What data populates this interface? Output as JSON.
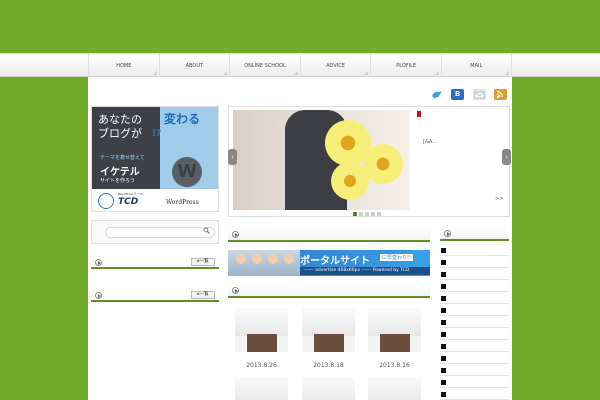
{
  "nav": {
    "items": [
      {
        "label": "HOME"
      },
      {
        "label": "ABOUT"
      },
      {
        "label": "ONLINE SCHOOL"
      },
      {
        "label": "ADVICE"
      },
      {
        "label": "PLOFILE"
      },
      {
        "label": "MAIL"
      }
    ]
  },
  "social": {
    "icons": [
      "bird-icon",
      "hatena-bookmark-icon",
      "mail-icon",
      "rss-icon"
    ],
    "b_label": "B"
  },
  "banner": {
    "line1": "あなたの",
    "line2": "ブログが",
    "kawaru": "変わる",
    "exclaim": "!?",
    "sub": "テーマを着せ替えて",
    "ikeru": "イケテル",
    "make": "サイトを作ろう",
    "tcd_small": "WordPressテーマ",
    "tcd": "TCD",
    "wordpress": "WordPress"
  },
  "sidebar": {
    "list_button": "▸一覧"
  },
  "slider": {
    "caption": "[&A...",
    "more": ">>",
    "dots_active": 1,
    "dots_total": 5
  },
  "ad": {
    "portal": "ポータルサイト",
    "tag": "に早変わり!!",
    "stripe": "------ advertise 468x60px ------ Powered by TCD"
  },
  "posts": {
    "dates": [
      "2013.8.26",
      "2013.8.18",
      "2013.8.16"
    ]
  },
  "colors": {
    "accent": "#70aa2b",
    "heading_rule": "#5f8f27"
  }
}
